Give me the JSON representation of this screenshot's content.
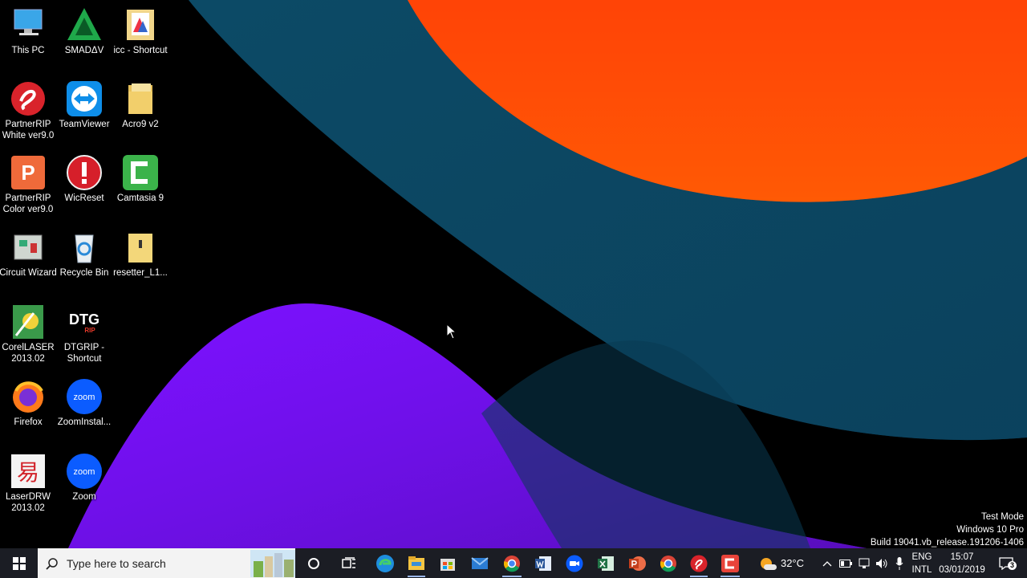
{
  "desktop": {
    "icons": [
      {
        "label": "This PC",
        "icon": "this-pc-icon"
      },
      {
        "label": "SMADΔV",
        "icon": "smadav-icon"
      },
      {
        "label": "icc - Shortcut",
        "icon": "icc-shortcut-icon"
      },
      {
        "label": "PartnerRIP White ver9.0",
        "icon": "partnerrip-white-icon"
      },
      {
        "label": "TeamViewer",
        "icon": "teamviewer-icon"
      },
      {
        "label": "Acro9 v2",
        "icon": "folder-icon"
      },
      {
        "label": "PartnerRIP Color ver9.0",
        "icon": "partnerrip-color-icon"
      },
      {
        "label": "WicReset",
        "icon": "wicreset-icon"
      },
      {
        "label": "Camtasia 9",
        "icon": "camtasia-icon"
      },
      {
        "label": "Circuit Wizard",
        "icon": "circuit-wizard-icon"
      },
      {
        "label": "Recycle Bin",
        "icon": "recycle-bin-icon"
      },
      {
        "label": "resetter_L1...",
        "icon": "zip-folder-icon"
      },
      {
        "label": "CorelLASER 2013.02",
        "icon": "corellaser-icon"
      },
      {
        "label": "DTGRIP - Shortcut",
        "icon": "dtgrip-icon"
      },
      {
        "label": "Firefox",
        "icon": "firefox-icon"
      },
      {
        "label": "ZoomInstal...",
        "icon": "zoom-installer-icon"
      },
      {
        "label": "LaserDRW 2013.02",
        "icon": "laserdrw-icon"
      },
      {
        "label": "Zoom",
        "icon": "zoom-icon"
      }
    ],
    "icon_glyphs": {
      "dtg": "DTG",
      "rip": "RIP",
      "zoom": "zoom",
      "partner_p": "P",
      "laser": "易"
    }
  },
  "watermark": {
    "line1": "Test Mode",
    "line2": "Windows 10 Pro",
    "line3": "Build 19041.vb_release.191206-1406"
  },
  "taskbar": {
    "search_placeholder": "Type here to search",
    "pinned": [
      "cortana-icon",
      "task-view-icon",
      "edge-icon",
      "file-explorer-icon",
      "store-icon",
      "mail-icon",
      "chrome-icon",
      "word-icon",
      "zoom-icon",
      "excel-icon",
      "powerpoint-icon",
      "chrome-icon",
      "partnerrip-icon",
      "camtasia-icon"
    ],
    "weather": {
      "temp": "32°C",
      "icon": "weather-icon"
    },
    "language": {
      "lang": "ENG",
      "layout": "INTL"
    },
    "clock": {
      "time": "15:07",
      "date": "03/01/2019"
    },
    "notification_count": "3"
  },
  "colors": {
    "orange": "#ff4a0a",
    "purple": "#8412ff",
    "teal": "#0c4a66",
    "taskbar": "#1b1d24"
  }
}
